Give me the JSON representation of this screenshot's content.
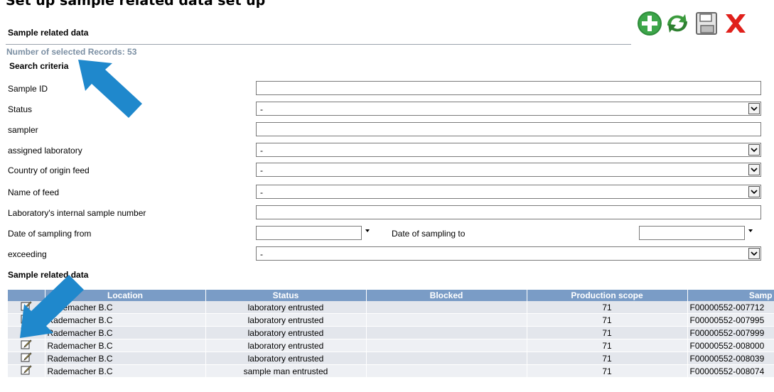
{
  "page": {
    "heading": "Set up sample related data set up"
  },
  "section": {
    "title": "Sample related data",
    "record_count": "Number of selected Records: 53"
  },
  "toolbar": {
    "add_icon": "add-circle-icon",
    "refresh_icon": "refresh-icon",
    "save_icon": "floppy-disk-icon",
    "close_icon": "red-x-icon"
  },
  "search": {
    "heading": "Search criteria",
    "sample_id": {
      "label": "Sample ID",
      "value": ""
    },
    "status": {
      "label": "Status",
      "value": "-"
    },
    "sampler": {
      "label": "sampler",
      "value": ""
    },
    "assigned_laboratory": {
      "label": "assigned laboratory",
      "value": "-"
    },
    "country_of_origin": {
      "label": "Country of origin feed",
      "value": "-"
    },
    "name_of_feed": {
      "label": "Name of feed",
      "value": "-"
    },
    "lab_internal_number": {
      "label": "Laboratory's internal sample number",
      "value": ""
    },
    "date_from": {
      "label": "Date of sampling from",
      "value": ""
    },
    "date_to": {
      "label": "Date of sampling to",
      "value": ""
    },
    "exceeding": {
      "label": "exceeding",
      "value": "-"
    }
  },
  "results": {
    "heading": "Sample related data",
    "columns": [
      "",
      "Location",
      "Status",
      "Blocked",
      "Production scope",
      "Samp"
    ],
    "rows": [
      {
        "location": "Rademacher B.C",
        "status": "laboratory entrusted",
        "blocked": "",
        "scope": "71",
        "sample": "F00000552-007712"
      },
      {
        "location": "Rademacher B.C",
        "status": "laboratory entrusted",
        "blocked": "",
        "scope": "71",
        "sample": "F00000552-007995"
      },
      {
        "location": "Rademacher B.C",
        "status": "laboratory entrusted",
        "blocked": "",
        "scope": "71",
        "sample": "F00000552-007999"
      },
      {
        "location": "Rademacher B.C",
        "status": "laboratory entrusted",
        "blocked": "",
        "scope": "71",
        "sample": "F00000552-008000"
      },
      {
        "location": "Rademacher B.C",
        "status": "laboratory entrusted",
        "blocked": "",
        "scope": "71",
        "sample": "F00000552-008039"
      },
      {
        "location": "Rademacher B.C",
        "status": "sample man entrusted",
        "blocked": "",
        "scope": "71",
        "sample": "F00000552-008074"
      }
    ]
  },
  "colors": {
    "header_bg": "#7a9cc6",
    "arrow": "#1f88cc",
    "add_green": "#2e8b3a",
    "close_red": "#e0201b"
  }
}
